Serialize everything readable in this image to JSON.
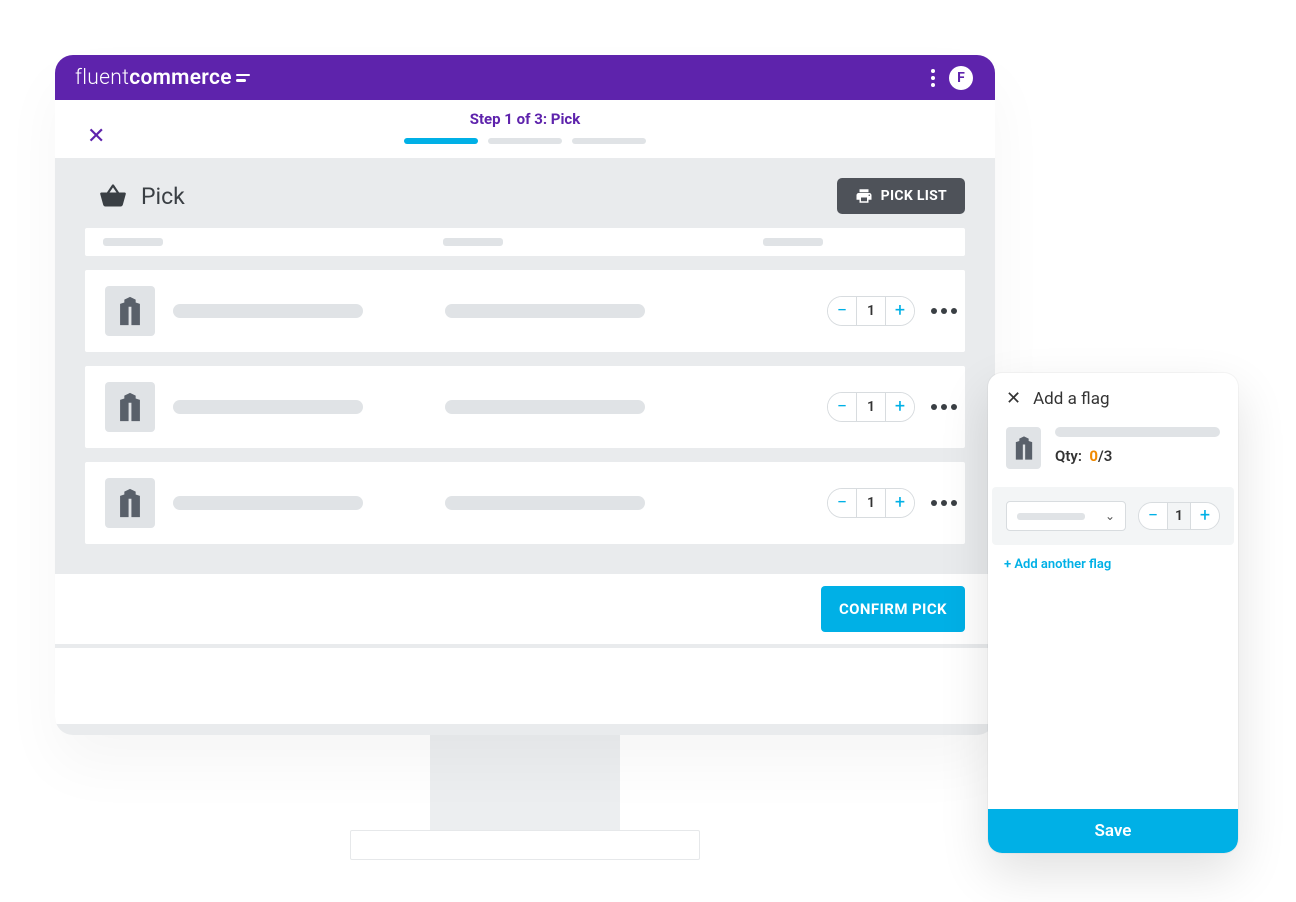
{
  "brand": {
    "name_light": "fluent",
    "name_bold": "commerce"
  },
  "header": {
    "avatar_initial": "F"
  },
  "wizard": {
    "step_label": "Step 1 of 3: Pick",
    "current_step": 1,
    "total_steps": 3
  },
  "page": {
    "title": "Pick"
  },
  "actions": {
    "pick_list_label": "PICK LIST",
    "confirm_label": "CONFIRM PICK"
  },
  "line_items": [
    {
      "qty": "1"
    },
    {
      "qty": "1"
    },
    {
      "qty": "1"
    }
  ],
  "flag_modal": {
    "title": "Add a flag",
    "qty_label": "Qty:",
    "qty_picked": "0",
    "qty_total": "/3",
    "stepper_value": "1",
    "add_another_label": "+ Add another flag",
    "save_label": "Save"
  }
}
